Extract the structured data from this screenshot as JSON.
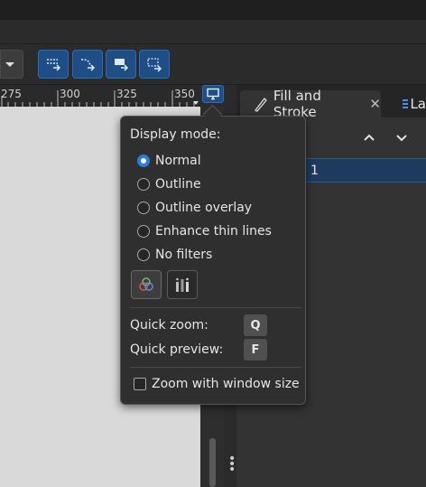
{
  "ruler": {
    "ticks": [
      "275",
      "300",
      "325",
      "350"
    ]
  },
  "panel": {
    "tabs": [
      {
        "label": "Fill and Stroke",
        "closable": true
      },
      {
        "label": "La"
      }
    ],
    "selected_row": "1"
  },
  "display_popup": {
    "title": "Display mode:",
    "modes": [
      {
        "label": "Normal",
        "selected": true
      },
      {
        "label": "Outline",
        "selected": false
      },
      {
        "label": "Outline overlay",
        "selected": false
      },
      {
        "label": "Enhance thin lines",
        "selected": false
      },
      {
        "label": "No filters",
        "selected": false
      }
    ],
    "quick_zoom_label": "Quick zoom:",
    "quick_zoom_key": "Q",
    "quick_preview_label": "Quick preview:",
    "quick_preview_key": "F",
    "zoom_with_window_label": "Zoom with window size",
    "zoom_with_window_checked": false
  },
  "colors": {
    "accent": "#2f79e0",
    "toolbar_button": "#1f4e86",
    "selection": "#1e3b5e"
  }
}
